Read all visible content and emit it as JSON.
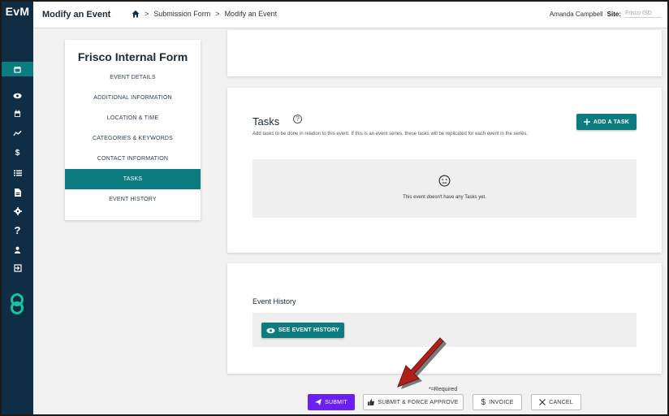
{
  "app": {
    "logo": "EvM"
  },
  "header": {
    "page_title": "Modify an Event",
    "breadcrumb": [
      "Submission Form",
      "Modify an Event"
    ],
    "separator": ">",
    "user_name": "Amanda Campbell",
    "site_label": "Site:",
    "site_value": "Frisco ISD"
  },
  "sidebar": {
    "items": [
      {
        "icon": "calendar-add-icon",
        "active": true
      },
      {
        "icon": "eye-icon"
      },
      {
        "icon": "calendar-icon"
      },
      {
        "icon": "trend-chart-icon"
      },
      {
        "icon": "dollar-icon",
        "glyph": "$"
      },
      {
        "icon": "list-icon"
      },
      {
        "icon": "document-icon"
      },
      {
        "icon": "gear-icon"
      },
      {
        "icon": "help-icon",
        "glyph": "?"
      },
      {
        "icon": "user-icon"
      },
      {
        "icon": "logout-icon"
      }
    ],
    "brand_icon": "brand-mark-icon",
    "colors": {
      "background": "#0f2d44",
      "active": "#0d7c80"
    }
  },
  "section_nav": {
    "title": "Frisco Internal Form",
    "items": [
      {
        "label": "EVENT DETAILS"
      },
      {
        "label": "ADDITIONAL INFORMATION"
      },
      {
        "label": "LOCATION & TIME"
      },
      {
        "label": "CATEGORIES & KEYWORDS"
      },
      {
        "label": "CONTACT INFORMATION"
      },
      {
        "label": "TASKS",
        "active": true
      },
      {
        "label": "EVENT HISTORY"
      }
    ]
  },
  "tasks": {
    "title": "Tasks",
    "description": "Add tasks to be done in relation to this event. If this is an event series, these tasks will be replicated for each event in the series.",
    "add_button": "ADD A TASK",
    "empty_message": "This event doesn't have any Tasks yet."
  },
  "history": {
    "title": "Event History",
    "button": "SEE EVENT HISTORY"
  },
  "footer": {
    "required_note": "*=Required",
    "submit": "SUBMIT",
    "submit_force": "SUBMIT & FORCE APPROVE",
    "invoice": "INVOICE",
    "cancel": "CANCEL"
  },
  "colors": {
    "accent": "#0d7c80",
    "submit": "#6a1ff5",
    "arrow": "#b0201a"
  }
}
